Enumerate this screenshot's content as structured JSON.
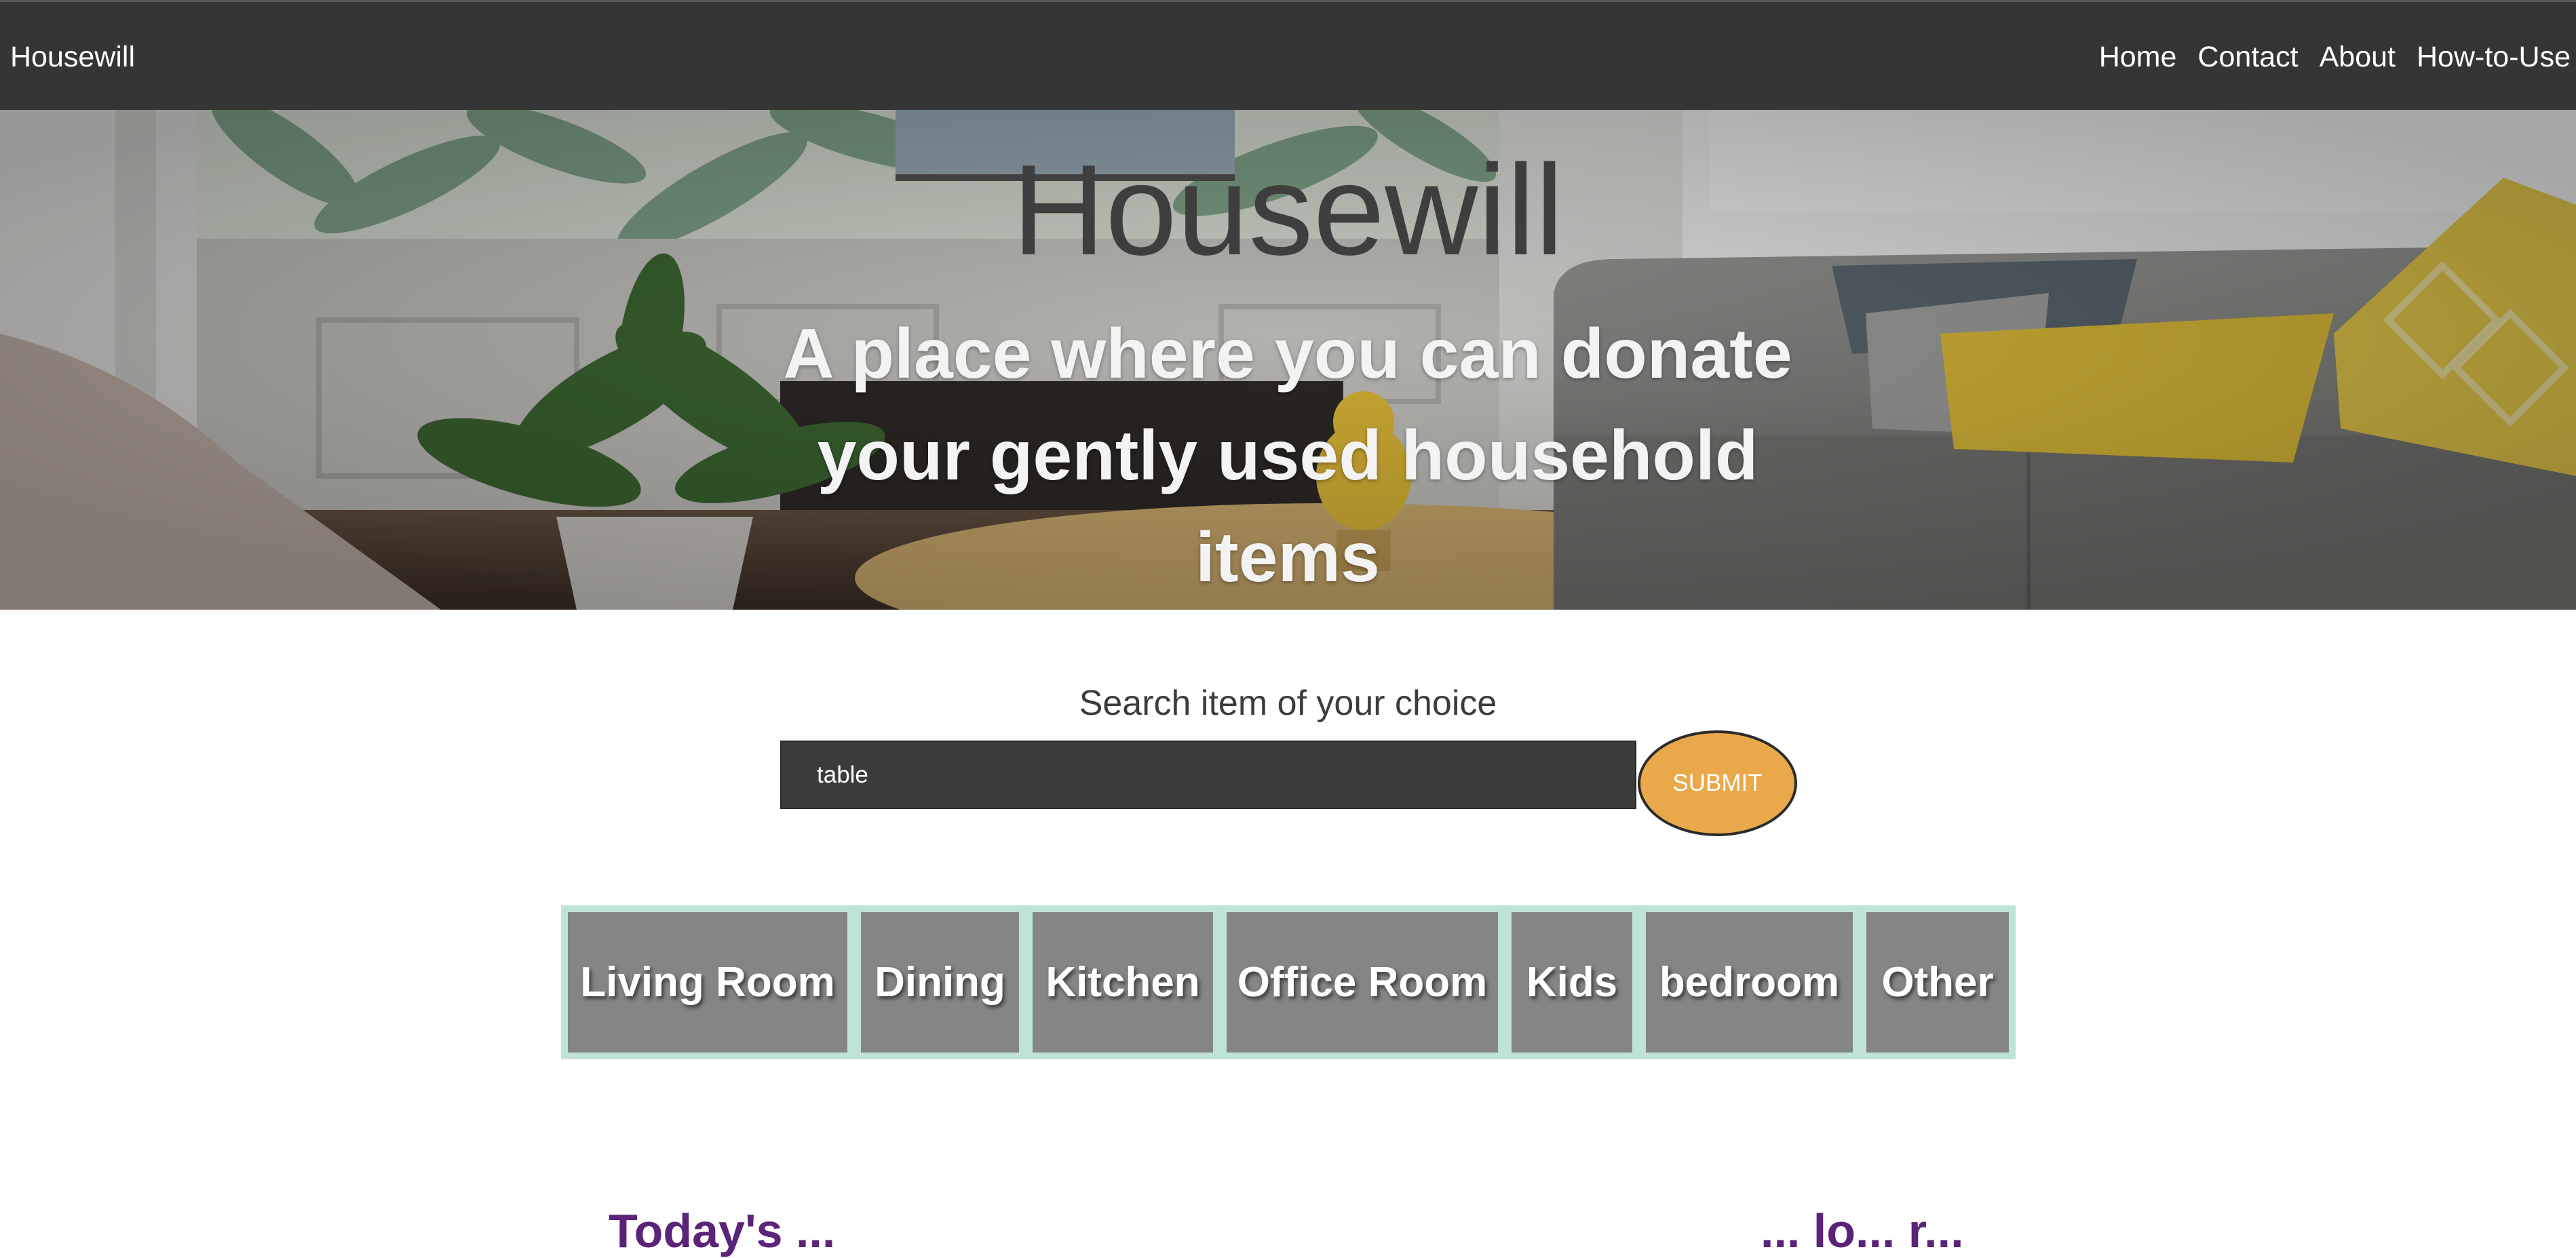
{
  "navbar": {
    "brand": "Housewill",
    "links": [
      {
        "label": "Home"
      },
      {
        "label": "Contact"
      },
      {
        "label": "About"
      },
      {
        "label": "How-to-Use"
      }
    ]
  },
  "hero": {
    "title": "Housewill",
    "subtitle": "A place where you can donate your gently used household items"
  },
  "search": {
    "label": "Search item of your choice",
    "value": "table",
    "submit_label": "SUBMIT"
  },
  "categories": [
    {
      "label": "Living Room"
    },
    {
      "label": "Dining"
    },
    {
      "label": "Kitchen"
    },
    {
      "label": "Office Room"
    },
    {
      "label": "Kids"
    },
    {
      "label": "bedroom"
    },
    {
      "label": "Other"
    }
  ],
  "bottom": {
    "left_heading": "Today's ...",
    "right_heading": "... lo... r..."
  },
  "colors": {
    "navbar_bg": "#353535",
    "submit_bg": "#e9a84a",
    "category_bg": "#858585",
    "category_frame": "#bfe4d7",
    "heading_purple": "#5b2379"
  }
}
